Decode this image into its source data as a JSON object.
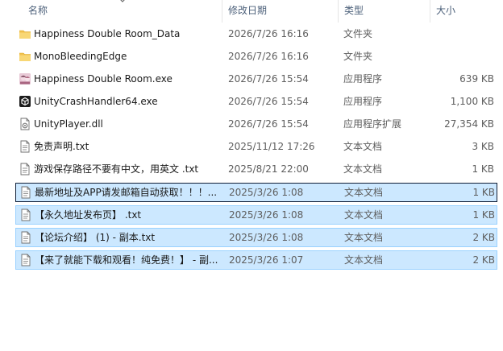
{
  "columns": {
    "name": "名称",
    "modified": "修改日期",
    "type": "类型",
    "size": "大小"
  },
  "files": [
    {
      "name": "Happiness Double Room_Data",
      "modified": "2026/7/26 16:16",
      "type": "文件夹",
      "size": "",
      "icon": "folder-icon",
      "selected": false
    },
    {
      "name": "MonoBleedingEdge",
      "modified": "2026/7/26 16:16",
      "type": "文件夹",
      "size": "",
      "icon": "folder-icon",
      "selected": false
    },
    {
      "name": "Happiness Double Room.exe",
      "modified": "2026/7/26 15:54",
      "type": "应用程序",
      "size": "639 KB",
      "icon": "game-exe-icon",
      "selected": false
    },
    {
      "name": "UnityCrashHandler64.exe",
      "modified": "2026/7/26 15:54",
      "type": "应用程序",
      "size": "1,100 KB",
      "icon": "unity-icon",
      "selected": false
    },
    {
      "name": "UnityPlayer.dll",
      "modified": "2026/7/26 15:54",
      "type": "应用程序扩展",
      "size": "27,354 KB",
      "icon": "dll-icon",
      "selected": false
    },
    {
      "name": "免责声明.txt",
      "modified": "2025/11/12 17:26",
      "type": "文本文档",
      "size": "3 KB",
      "icon": "text-file-icon",
      "selected": false
    },
    {
      "name": "游戏保存路径不要有中文，用英文 .txt",
      "modified": "2025/8/21 22:00",
      "type": "文本文档",
      "size": "1 KB",
      "icon": "text-file-icon",
      "selected": false
    },
    {
      "name": "最新地址及APP请发邮箱自动获取！！！...",
      "modified": "2025/3/26 1:08",
      "type": "文本文档",
      "size": "1 KB",
      "icon": "text-file-icon",
      "selected": true,
      "focused": true
    },
    {
      "name": "【永久地址发布页】 .txt",
      "modified": "2025/3/26 1:08",
      "type": "文本文档",
      "size": "1 KB",
      "icon": "text-file-icon",
      "selected": true
    },
    {
      "name": "【论坛介绍】 (1) - 副本.txt",
      "modified": "2025/3/26 1:08",
      "type": "文本文档",
      "size": "2 KB",
      "icon": "text-file-icon",
      "selected": true
    },
    {
      "name": "【来了就能下载和观看！纯免费！】 - 副...",
      "modified": "2025/3/26 1:07",
      "type": "文本文档",
      "size": "2 KB",
      "icon": "text-file-icon",
      "selected": true
    }
  ]
}
